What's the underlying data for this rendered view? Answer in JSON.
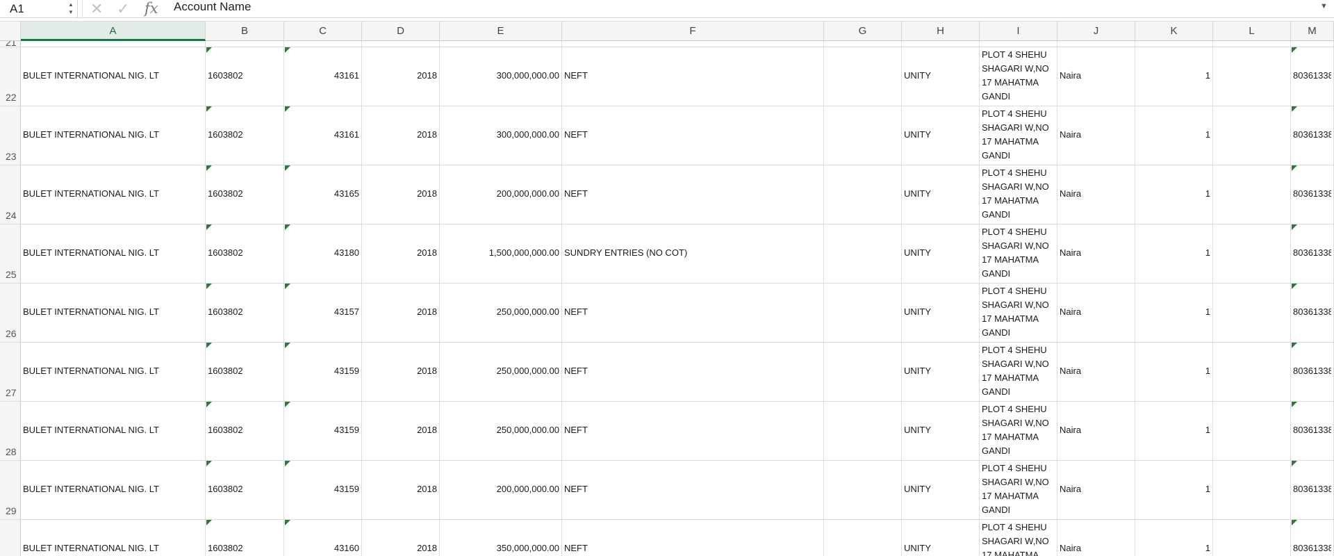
{
  "name_box": {
    "value": "A1"
  },
  "formula_bar": {
    "content": "Account Name",
    "fx_label": "fx"
  },
  "columns": [
    "A",
    "B",
    "C",
    "D",
    "E",
    "F",
    "G",
    "H",
    "I",
    "J",
    "K",
    "L",
    "M"
  ],
  "row_numbers": [
    "21",
    "22",
    "23",
    "24",
    "25",
    "26",
    "27",
    "28",
    "29"
  ],
  "rows": [
    {
      "a": "BULET INTERNATIONAL NIG. LT",
      "b": "1603802",
      "c": "43161",
      "d": "2018",
      "e": "300,000,000.00",
      "f": "NEFT",
      "h": "UNITY",
      "i": "PLOT 4   SHEHU SHAGARI W,NO 17 MAHATMA GANDI ASOKORO",
      "j": "Naira",
      "k": "1",
      "m": "80361338"
    },
    {
      "a": "BULET INTERNATIONAL NIG. LT",
      "b": "1603802",
      "c": "43161",
      "d": "2018",
      "e": "300,000,000.00",
      "f": "NEFT",
      "h": "UNITY",
      "i": "PLOT 4   SHEHU SHAGARI W,NO 17 MAHATMA GANDI ASOKORO",
      "j": "Naira",
      "k": "1",
      "m": "80361338"
    },
    {
      "a": "BULET INTERNATIONAL NIG. LT",
      "b": "1603802",
      "c": "43165",
      "d": "2018",
      "e": "200,000,000.00",
      "f": "NEFT",
      "h": "UNITY",
      "i": "PLOT 4   SHEHU SHAGARI W,NO 17 MAHATMA GANDI ASOKORO",
      "j": "Naira",
      "k": "1",
      "m": "80361338"
    },
    {
      "a": "BULET INTERNATIONAL NIG. LT",
      "b": "1603802",
      "c": "43180",
      "d": "2018",
      "e": "1,500,000,000.00",
      "f": "SUNDRY ENTRIES (NO COT)",
      "h": "UNITY",
      "i": "PLOT 4   SHEHU SHAGARI W,NO 17 MAHATMA GANDI ASOKORO",
      "j": "Naira",
      "k": "1",
      "m": "80361338"
    },
    {
      "a": "BULET INTERNATIONAL NIG. LT",
      "b": "1603802",
      "c": "43157",
      "d": "2018",
      "e": "250,000,000.00",
      "f": "NEFT",
      "h": "UNITY",
      "i": "PLOT 4   SHEHU SHAGARI W,NO 17 MAHATMA GANDI ASOKORO",
      "j": "Naira",
      "k": "1",
      "m": "80361338"
    },
    {
      "a": "BULET INTERNATIONAL NIG. LT",
      "b": "1603802",
      "c": "43159",
      "d": "2018",
      "e": "250,000,000.00",
      "f": "NEFT",
      "h": "UNITY",
      "i": "PLOT 4   SHEHU SHAGARI W,NO 17 MAHATMA GANDI ASOKORO",
      "j": "Naira",
      "k": "1",
      "m": "80361338"
    },
    {
      "a": "BULET INTERNATIONAL NIG. LT",
      "b": "1603802",
      "c": "43159",
      "d": "2018",
      "e": "250,000,000.00",
      "f": "NEFT",
      "h": "UNITY",
      "i": "PLOT 4   SHEHU SHAGARI W,NO 17 MAHATMA GANDI ASOKORO",
      "j": "Naira",
      "k": "1",
      "m": "80361338"
    },
    {
      "a": "BULET INTERNATIONAL NIG. LT",
      "b": "1603802",
      "c": "43159",
      "d": "2018",
      "e": "200,000,000.00",
      "f": "NEFT",
      "h": "UNITY",
      "i": "PLOT 4   SHEHU SHAGARI W,NO 17 MAHATMA GANDI ASOKORO",
      "j": "Naira",
      "k": "1",
      "m": "80361338"
    },
    {
      "a": "BULET INTERNATIONAL NIG. LT",
      "b": "1603802",
      "c": "43160",
      "d": "2018",
      "e": "350,000,000.00",
      "f": "NEFT",
      "h": "UNITY",
      "i": "PLOT 4   SHEHU SHAGARI W,NO 17 MAHATMA GANDI ASOKORO",
      "j": "Naira",
      "k": "1",
      "m": "80361338"
    }
  ],
  "colors": {
    "accent": "#1e7145",
    "comment_indicator": "#2b7a3a",
    "grid_line": "#dcdcdc"
  },
  "icons": {
    "cancel": "cancel-icon",
    "enter": "enter-icon",
    "function": "fx-icon"
  }
}
